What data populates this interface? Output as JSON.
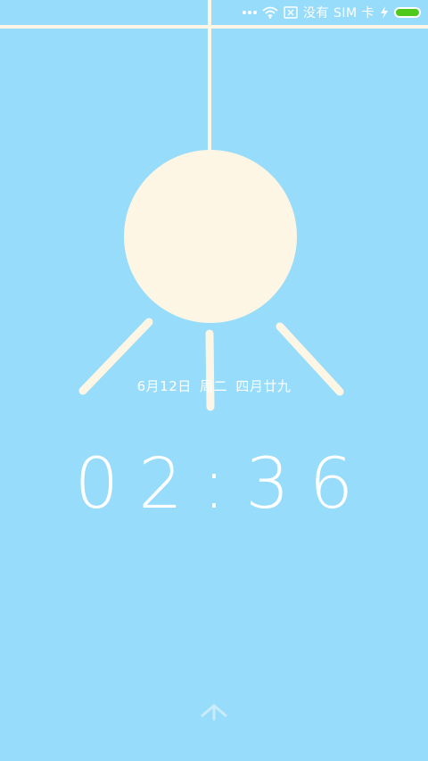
{
  "status_bar": {
    "carrier": "没有 SIM 卡",
    "icons": [
      "more-dots-icon",
      "wifi-icon",
      "no-sim-icon",
      "charging-bolt-icon",
      "battery-icon"
    ],
    "battery_color": "#4ec91c",
    "battery_level": 1.0
  },
  "lockscreen": {
    "date": "6月12日",
    "weekday": "周二",
    "lunar_date": "四月廿九",
    "time": "02:36",
    "unlock_icon": "chevron-up-icon"
  },
  "colors": {
    "background": "#97dcfb",
    "lamp": "#fdf6e4",
    "text": "#ffffff"
  }
}
